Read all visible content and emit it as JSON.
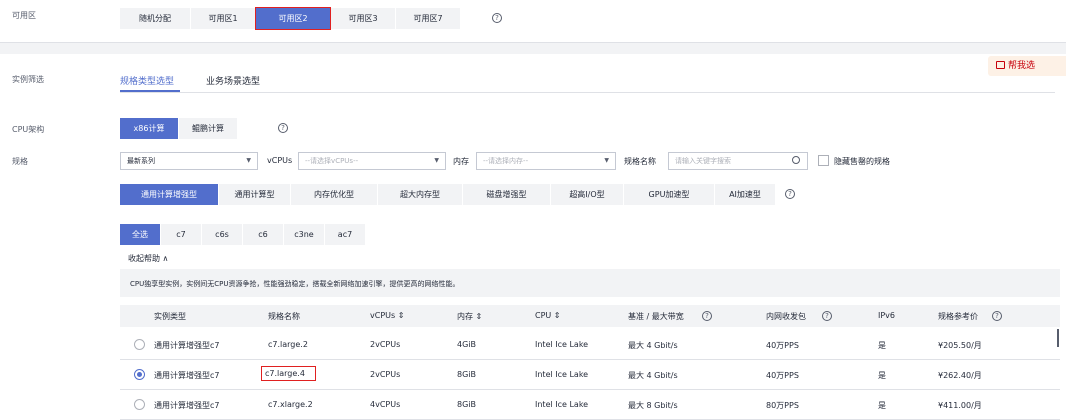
{
  "az": {
    "label": "可用区",
    "options": [
      "随机分配",
      "可用区1",
      "可用区2",
      "可用区3",
      "可用区7"
    ],
    "selected_index": 2,
    "help": "?"
  },
  "filter": {
    "label": "实例筛选",
    "tabs": [
      "规格类型选型",
      "业务场景选型"
    ],
    "active_tab": 0,
    "help_me_pick": "帮我选"
  },
  "cpu_arch": {
    "label": "CPU架构",
    "options": [
      "x86计算",
      "鲲鹏计算"
    ],
    "selected_index": 0,
    "help": "?"
  },
  "spec": {
    "label": "规格",
    "series": "最新系列",
    "vcpus_label": "vCPUs",
    "vcpus_placeholder": "--请选择vCPUs--",
    "mem_label": "内存",
    "mem_placeholder": "--请选择内存--",
    "name_label": "规格名称",
    "name_placeholder": "请输入关键字搜索",
    "hide_soldout": "隐藏售罄的规格",
    "types": [
      "通用计算增强型",
      "通用计算型",
      "内存优化型",
      "超大内存型",
      "磁盘增强型",
      "超高I/O型",
      "GPU加速型",
      "AI加速型"
    ],
    "type_selected": 0,
    "subs": [
      "全选",
      "c7",
      "c6s",
      "c6",
      "c3ne",
      "ac7"
    ],
    "sub_selected": 0,
    "collapse": "收起帮助 ∧",
    "desc": "CPU独享型实例，实例间无CPU资源争抢，性能强劲稳定，搭载全新网络加速引擎，提供更高的网络性能。"
  },
  "table": {
    "headers": [
      "实例类型",
      "规格名称",
      "vCPUs ⇕",
      "内存 ⇕",
      "CPU ⇕",
      "基准 / 最大带宽",
      "内网收发包",
      "IPv6",
      "规格参考价"
    ],
    "rows": [
      {
        "type": "通用计算增强型c7",
        "name": "c7.large.2",
        "vcpus": "2vCPUs",
        "mem": "4GiB",
        "cpu": "Intel Ice Lake",
        "bw": "最大 4 Gbit/s",
        "pps": "40万PPS",
        "ipv6": "是",
        "price": "¥205.50/月",
        "selected": false
      },
      {
        "type": "通用计算增强型c7",
        "name": "c7.large.4",
        "vcpus": "2vCPUs",
        "mem": "8GiB",
        "cpu": "Intel Ice Lake",
        "bw": "最大 4 Gbit/s",
        "pps": "40万PPS",
        "ipv6": "是",
        "price": "¥262.40/月",
        "selected": true
      },
      {
        "type": "通用计算增强型c7",
        "name": "c7.xlarge.2",
        "vcpus": "4vCPUs",
        "mem": "8GiB",
        "cpu": "Intel Ice Lake",
        "bw": "最大 8 Gbit/s",
        "pps": "80万PPS",
        "ipv6": "是",
        "price": "¥411.00/月",
        "selected": false
      }
    ]
  },
  "colors": {
    "accent": "#526ecc",
    "highlight": "#e02020",
    "help_btn_bg": "#fdf1e6"
  }
}
